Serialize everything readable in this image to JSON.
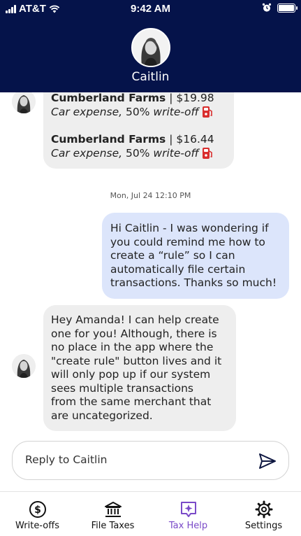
{
  "status_bar": {
    "carrier": "AT&T",
    "time": "9:42 AM"
  },
  "header": {
    "contact_name": "Caitlin"
  },
  "messages": {
    "receipts": [
      {
        "merchant": "Cumberland Farms",
        "amount": "| $19.98",
        "category": "Car expense,",
        "percent": "50%",
        "write_off": "write-off"
      },
      {
        "merchant": "Cumberland Farms",
        "amount": "| $16.44",
        "category": "Car expense,",
        "percent": "50%",
        "write_off": "write-off"
      }
    ],
    "timestamp": "Mon, Jul 24 12:10 PM",
    "outgoing": [
      "Hi Caitlin - I was wondering if",
      "you could remind me how to",
      "create a “rule” so I can",
      "automatically file certain",
      "transactions. Thanks so much!"
    ],
    "incoming": [
      "Hey Amanda! I can help create",
      "one for you! Although, there is",
      "no place in the app where the",
      "\"create rule\" button lives and it",
      "will only pop up if our system",
      "sees multiple transactions",
      "from the same merchant that",
      "are uncategorized."
    ]
  },
  "reply": {
    "placeholder": "Reply to Caitlin"
  },
  "tabs": [
    {
      "label": "Write-offs",
      "icon": "dollar-circle-icon"
    },
    {
      "label": "File Taxes",
      "icon": "bank-icon"
    },
    {
      "label": "Tax Help",
      "icon": "sparkle-chat-icon",
      "active": true
    },
    {
      "label": "Settings",
      "icon": "gear-icon"
    }
  ],
  "colors": {
    "header_bg": "#05134a",
    "incoming_bubble": "#eeeeee",
    "outgoing_bubble": "#dce5fb",
    "active_tab": "#7a4ac8",
    "fuel_icon": "#d92d2d"
  }
}
